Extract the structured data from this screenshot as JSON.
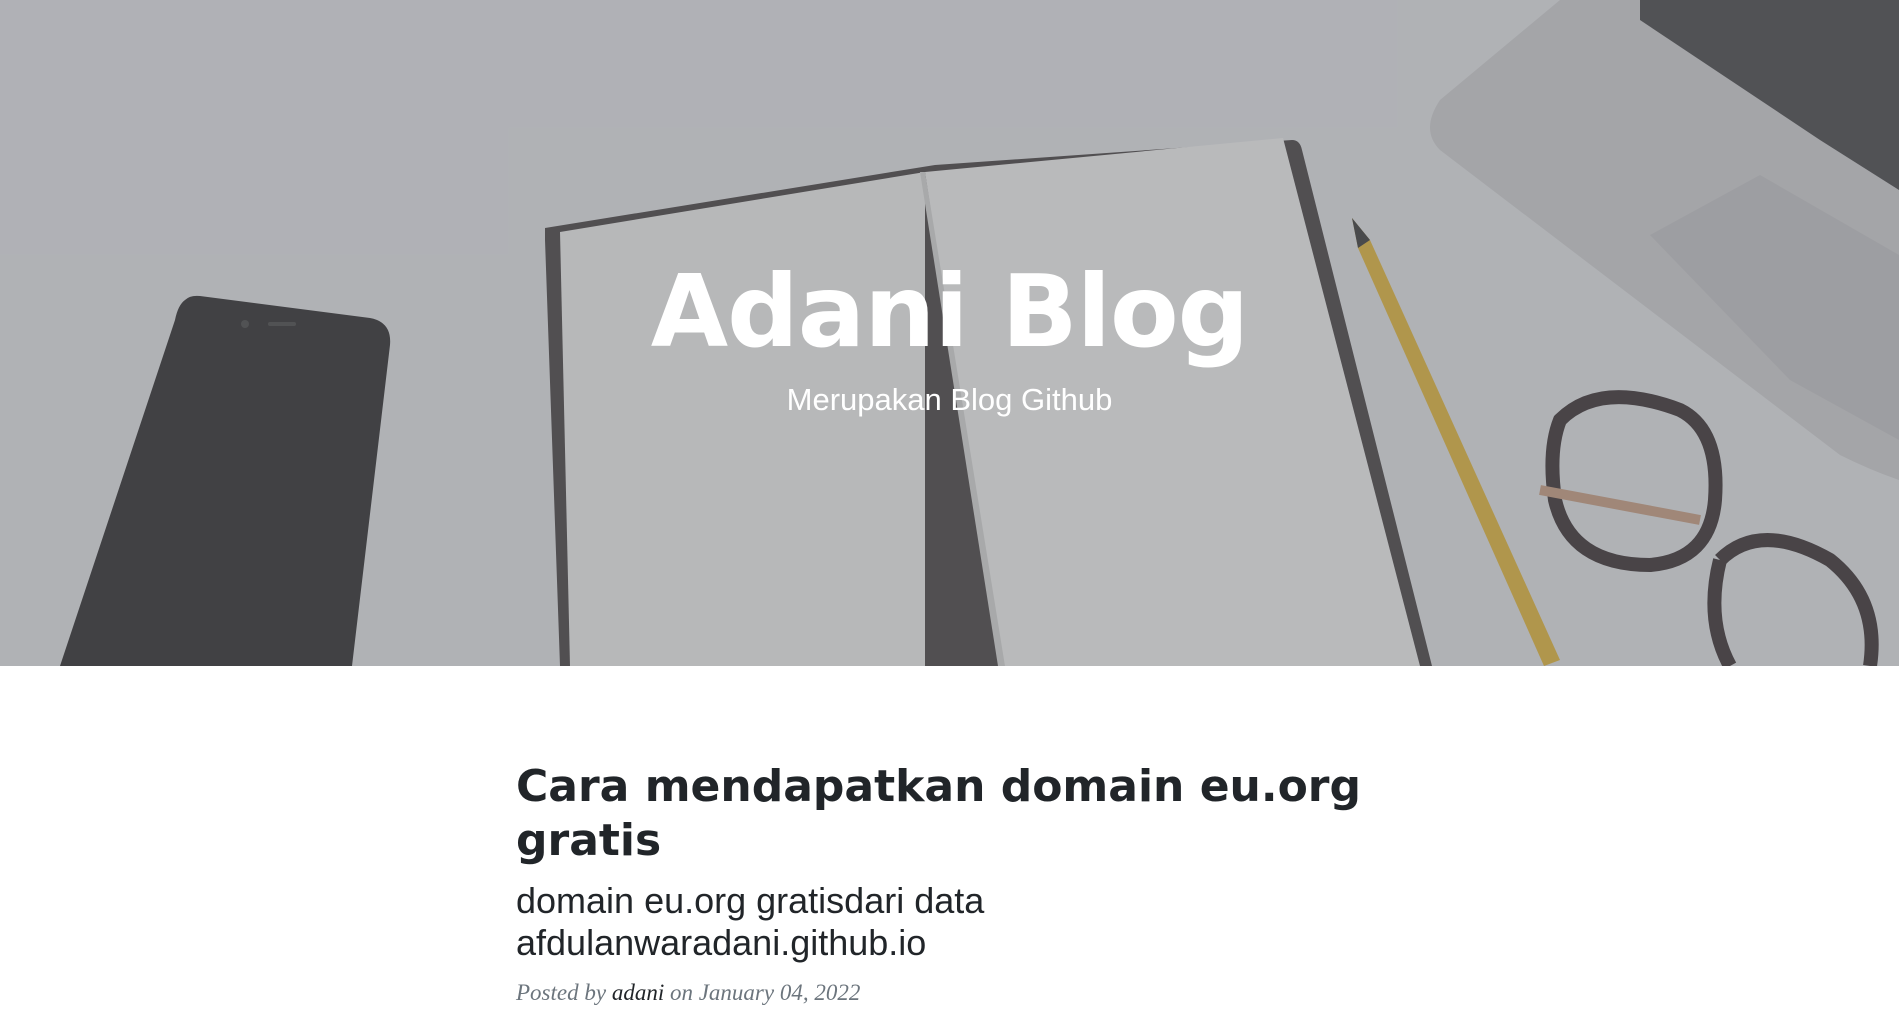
{
  "header": {
    "title": "Adani Blog",
    "subtitle": "Merupakan Blog Github"
  },
  "posts": [
    {
      "title": "Cara mendapatkan domain eu.org gratis",
      "subtitle": "domain eu.org gratisdari data afdulanwaradani.github.io",
      "meta_prefix": "Posted by",
      "author": "adani",
      "meta_on": "on",
      "date": "January 04, 2022"
    }
  ],
  "colors": {
    "overlay": "#6e7076",
    "text_dark": "#212529",
    "meta_gray": "#6c757d"
  },
  "icons": [
    "hero-photo-phone",
    "hero-photo-notebook",
    "hero-photo-pencil",
    "hero-photo-glasses",
    "hero-photo-laptop"
  ]
}
